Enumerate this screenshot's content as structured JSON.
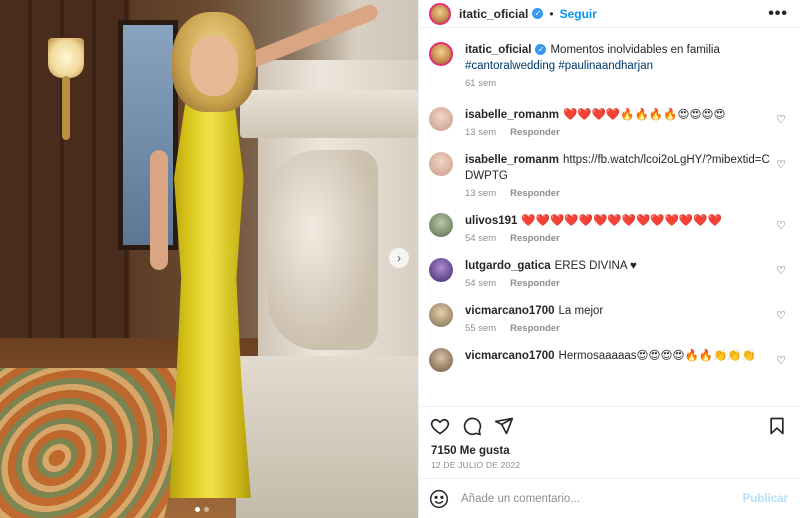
{
  "header": {
    "username": "itatic_oficial",
    "follow_label": "Seguir",
    "more_label": "•••"
  },
  "caption": {
    "username": "itatic_oficial",
    "text": "Momentos inolvidables en familia",
    "hashtags": "#cantoralwedding #paulinaandharjan",
    "time": "61 sem"
  },
  "comments": [
    {
      "username": "isabelle_romanm",
      "text": "❤️❤️❤️❤️🔥🔥🔥🔥😍😍😍😍",
      "time": "13 sem",
      "reply": "Responder"
    },
    {
      "username": "isabelle_romanm",
      "text": "https://fb.watch/lcoi2oLgHY/?mibextid=CDWPTG",
      "time": "13 sem",
      "reply": "Responder"
    },
    {
      "username": "ulivos191",
      "text": "❤️❤️❤️❤️❤️❤️❤️❤️❤️❤️❤️❤️❤️❤️",
      "time": "54 sem",
      "reply": "Responder"
    },
    {
      "username": "lutgardo_gatica",
      "text": "ERES DIVINA ♥",
      "time": "54 sem",
      "reply": "Responder"
    },
    {
      "username": "vicmarcano1700",
      "text": "La mejor",
      "time": "55 sem",
      "reply": "Responder"
    },
    {
      "username": "vicmarcano1700",
      "text": "Hermosaaaaas😍😍😍😍🔥🔥👏👏👏",
      "time": "",
      "reply": ""
    }
  ],
  "post": {
    "likes": "7150 Me gusta",
    "date": "12 DE JULIO DE 2022"
  },
  "add_comment": {
    "placeholder": "Añade un comentario...",
    "publish_label": "Publicar"
  },
  "colors": {
    "link_blue": "#0095f6",
    "verified": "#3897f0",
    "publish_disabled": "#b2dffc",
    "muted": "#8e8e8e"
  },
  "icons": [
    "chevron-right-icon",
    "more-icon",
    "heart-icon",
    "comment-icon",
    "share-icon",
    "bookmark-icon",
    "emoji-icon",
    "verified-icon"
  ]
}
